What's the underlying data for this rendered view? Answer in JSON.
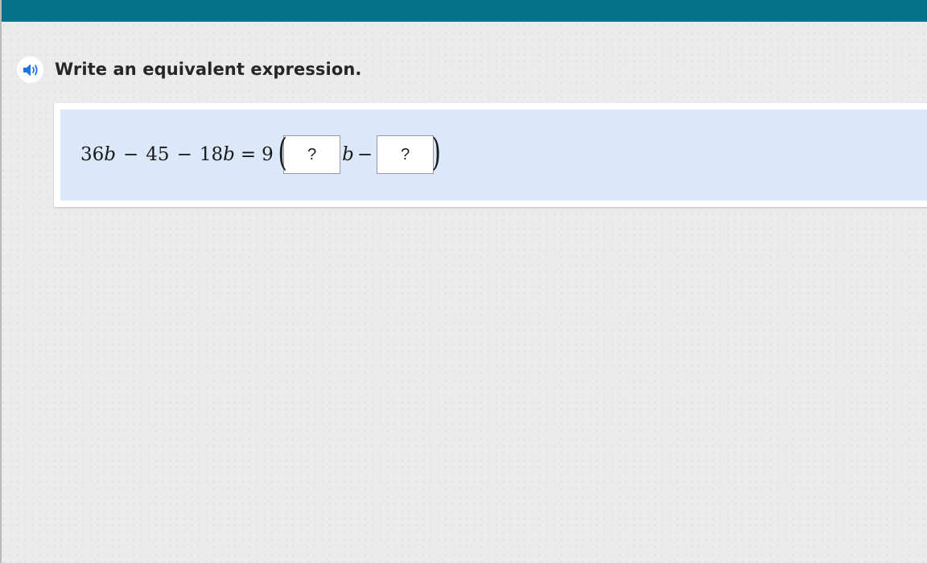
{
  "header": {
    "bar_color": "#06738a"
  },
  "audio": {
    "icon": "speaker-icon",
    "icon_color": "#1a73e8"
  },
  "question": {
    "prompt": "Write an equivalent expression."
  },
  "equation": {
    "term1_coef": "36",
    "term1_var": "b",
    "minus1": "−",
    "term2": "45",
    "minus2": "−",
    "term3_coef": "18",
    "term3_var": "b",
    "equals": "=",
    "factor": "9",
    "open_paren": "(",
    "inner_var": "b",
    "inner_minus": "−",
    "close_paren": ")",
    "answer_1": {
      "value": "",
      "placeholder": "?"
    },
    "answer_2": {
      "value": "",
      "placeholder": "?"
    }
  }
}
